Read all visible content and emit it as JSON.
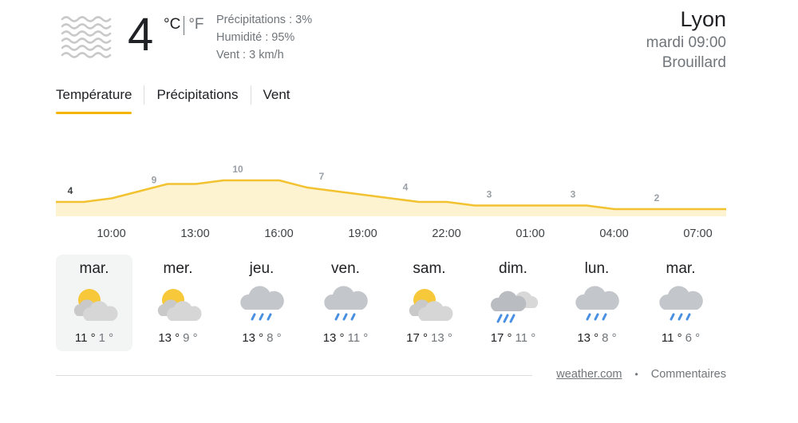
{
  "current": {
    "icon": "fog-icon",
    "temperature": "4",
    "unit_c": "°C",
    "unit_f": "°F",
    "precipitation": "Précipitations : 3%",
    "humidity": "Humidité : 95%",
    "wind": "Vent : 3 km/h"
  },
  "location": {
    "city": "Lyon",
    "datetime": "mardi 09:00",
    "condition": "Brouillard"
  },
  "tabs": [
    {
      "label": "Température",
      "active": true
    },
    {
      "label": "Précipitations",
      "active": false
    },
    {
      "label": "Vent",
      "active": false
    }
  ],
  "colors": {
    "accent": "#f4b400",
    "line": "#f2c230",
    "fill": "#fdf3d0",
    "text_primary": "#202124",
    "text_secondary": "#70757a"
  },
  "chart_data": {
    "type": "area",
    "x": [
      "09:00",
      "10:00",
      "11:00",
      "12:00",
      "13:00",
      "14:00",
      "15:00",
      "16:00",
      "17:00",
      "18:00",
      "19:00",
      "20:00",
      "21:00",
      "22:00",
      "23:00",
      "00:00",
      "01:00",
      "02:00",
      "03:00",
      "04:00",
      "05:00",
      "06:00",
      "07:00",
      "08:00",
      "09:00"
    ],
    "values": [
      4,
      4,
      5,
      7,
      9,
      9,
      10,
      10,
      10,
      8,
      7,
      6,
      5,
      4,
      4,
      3,
      3,
      3,
      3,
      3,
      2,
      2,
      2,
      2,
      2
    ],
    "labels": [
      {
        "hour_index": 0,
        "text": "4",
        "current": true
      },
      {
        "hour_index": 3,
        "text": "9"
      },
      {
        "hour_index": 6,
        "text": "10"
      },
      {
        "hour_index": 9,
        "text": "7"
      },
      {
        "hour_index": 12,
        "text": "4"
      },
      {
        "hour_index": 15,
        "text": "3"
      },
      {
        "hour_index": 18,
        "text": "3"
      },
      {
        "hour_index": 21,
        "text": "2"
      }
    ],
    "tick_labels": [
      {
        "hour_index": 1.5,
        "text": "10:00"
      },
      {
        "hour_index": 4.5,
        "text": "13:00"
      },
      {
        "hour_index": 7.5,
        "text": "16:00"
      },
      {
        "hour_index": 10.5,
        "text": "19:00"
      },
      {
        "hour_index": 13.5,
        "text": "22:00"
      },
      {
        "hour_index": 16.5,
        "text": "01:00"
      },
      {
        "hour_index": 19.5,
        "text": "04:00"
      },
      {
        "hour_index": 22.5,
        "text": "07:00"
      }
    ],
    "ylim": [
      0,
      11
    ],
    "grid": false
  },
  "forecast": [
    {
      "day": "mar.",
      "icon": "partly-cloudy-icon",
      "high": "11 °",
      "low": "1 °",
      "selected": true
    },
    {
      "day": "mer.",
      "icon": "partly-cloudy-icon",
      "high": "13 °",
      "low": "9 °",
      "selected": false
    },
    {
      "day": "jeu.",
      "icon": "rain-icon",
      "high": "13 °",
      "low": "8 °",
      "selected": false
    },
    {
      "day": "ven.",
      "icon": "rain-icon",
      "high": "13 °",
      "low": "11 °",
      "selected": false
    },
    {
      "day": "sam.",
      "icon": "partly-cloudy-icon",
      "high": "17 °",
      "low": "13 °",
      "selected": false
    },
    {
      "day": "dim.",
      "icon": "scattered-showers-icon",
      "high": "17 °",
      "low": "11 °",
      "selected": false
    },
    {
      "day": "lun.",
      "icon": "rain-icon",
      "high": "13 °",
      "low": "8 °",
      "selected": false
    },
    {
      "day": "mar.",
      "icon": "rain-icon",
      "high": "11 °",
      "low": "6 °",
      "selected": false
    }
  ],
  "footer": {
    "source": "weather.com",
    "separator": "•",
    "feedback": "Commentaires"
  }
}
